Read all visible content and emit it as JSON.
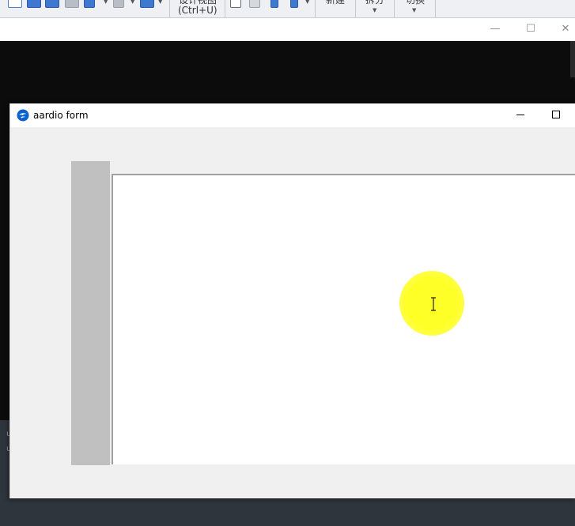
{
  "ribbon": {
    "design_view_top": "设计视图",
    "design_view_shortcut": "(Ctrl+U)",
    "new_label": "新建",
    "split_label": "拆分",
    "switch_label": "切换"
  },
  "ide_window": {
    "minimize_glyph": "—",
    "maximize_glyph": "☐",
    "close_glyph": "✕"
  },
  "output": {
    "line1": "u",
    "line2": "u"
  },
  "form": {
    "title": "aardio form",
    "logo_icon": "aardio-logo-icon",
    "accent_color": "#0a5fd1"
  },
  "colors": {
    "editor_bg": "#0c0c0c",
    "gutter": "#c0c0c0",
    "cursor_highlight": "#ffff33"
  }
}
